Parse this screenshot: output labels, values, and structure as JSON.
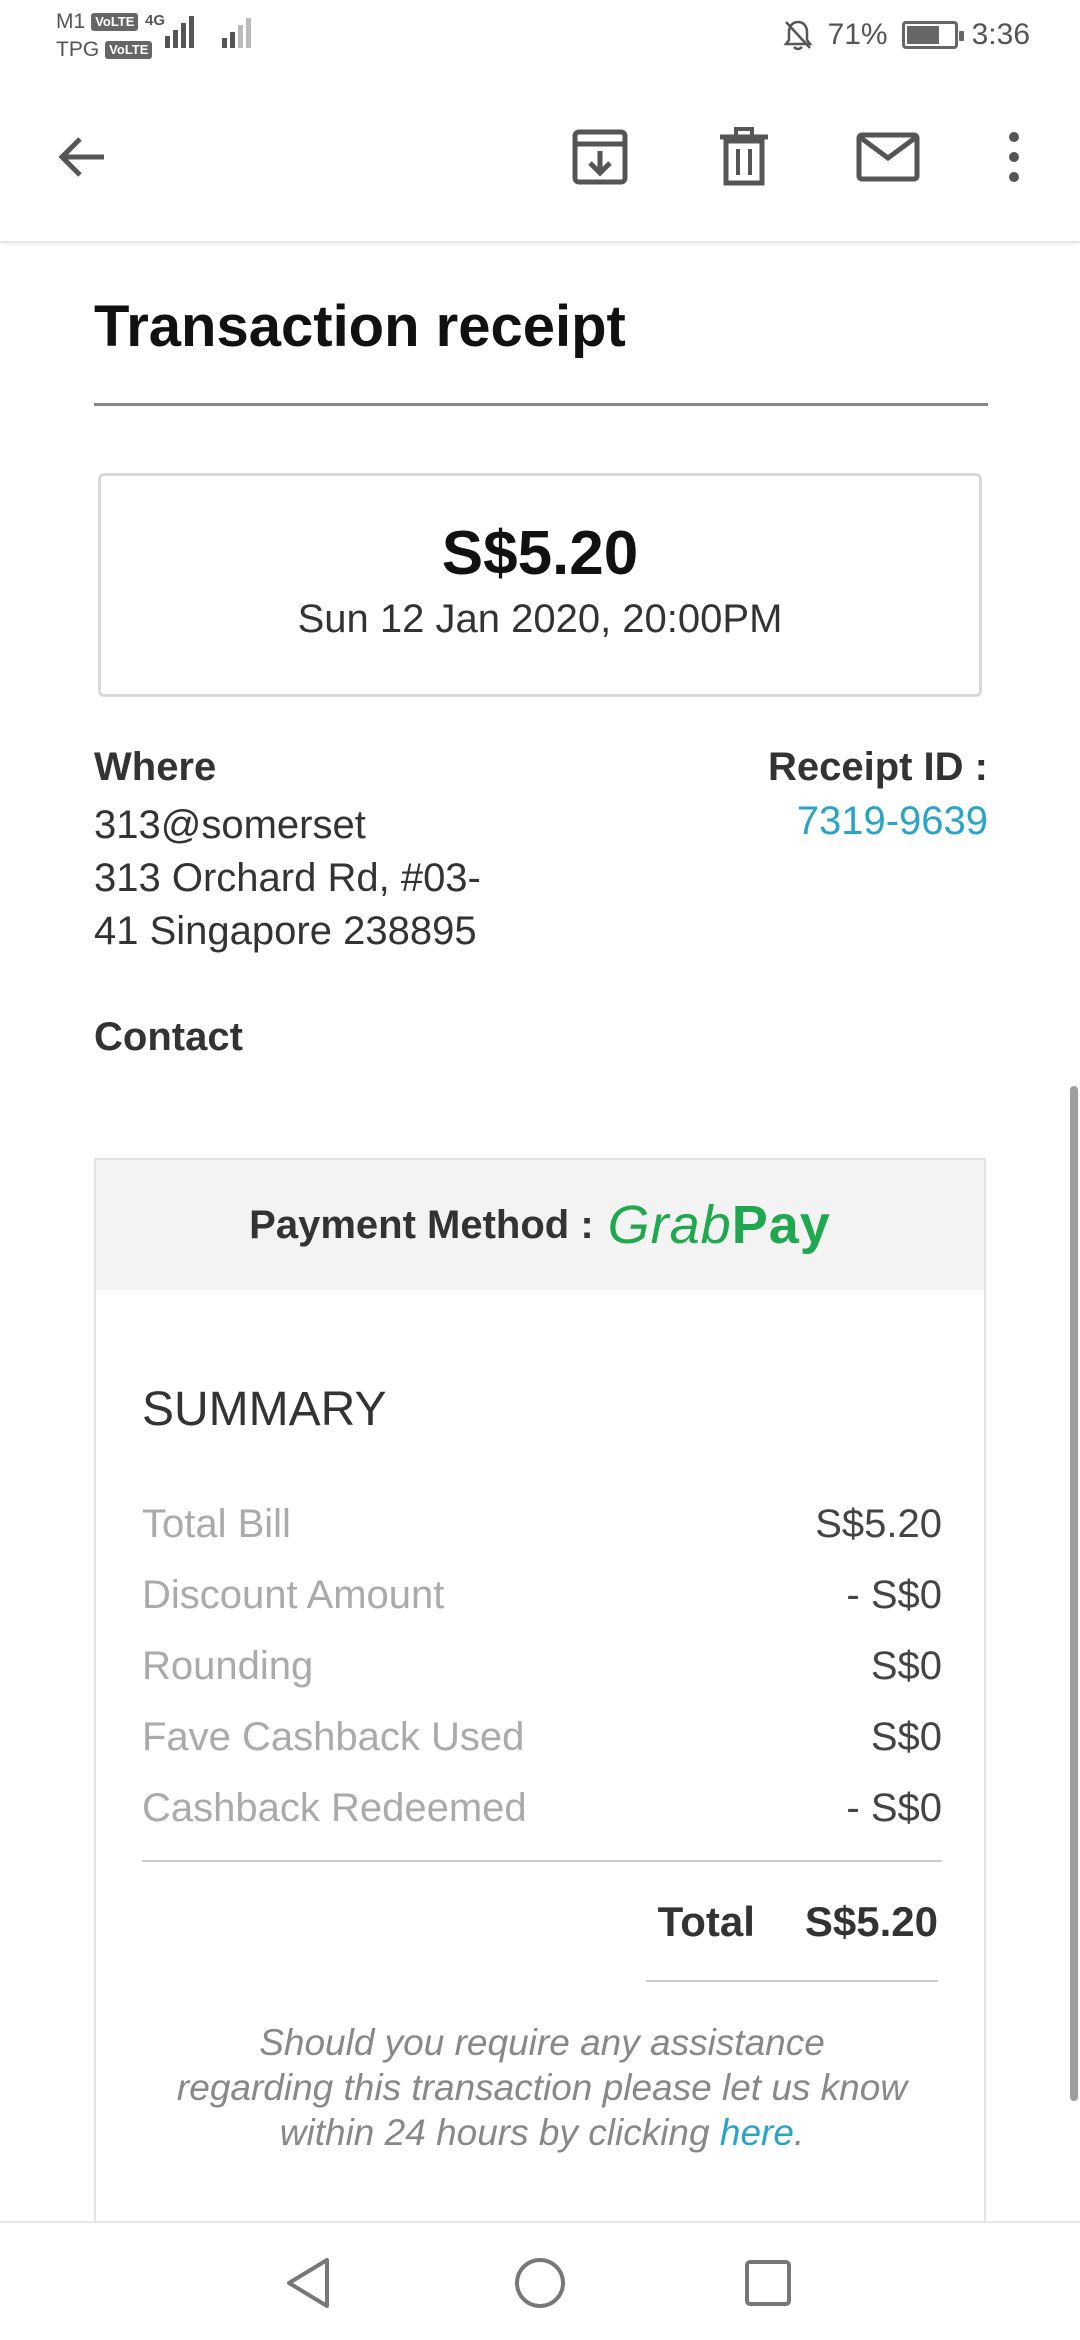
{
  "status_bar": {
    "carrier1": "M1",
    "carrier2": "TPG",
    "volte": "VoLTE",
    "network": "4G",
    "battery_percent": "71%",
    "battery_level": 0.71,
    "time": "3:36"
  },
  "toolbar": {
    "back_icon": "arrow-left-icon",
    "archive_icon": "archive-icon",
    "delete_icon": "trash-icon",
    "mail_icon": "mail-icon",
    "more_icon": "more-vertical-icon"
  },
  "receipt": {
    "title": "Transaction receipt",
    "amount": "S$5.20",
    "date": "Sun 12 Jan 2020, 20:00PM",
    "where_label": "Where",
    "where_name": "313@somerset",
    "where_addr1": "313 Orchard Rd, #03-",
    "where_addr2": "41 Singapore 238895",
    "receipt_id_label": "Receipt ID :",
    "receipt_id": "7319-9639",
    "contact_label": "Contact"
  },
  "payment": {
    "label": "Payment Method :",
    "brand_part1": "Grab",
    "brand_part2": "Pay",
    "brand_color": "#1fa84f"
  },
  "summary": {
    "title": "SUMMARY",
    "rows": [
      {
        "label": "Total Bill",
        "value": "S$5.20"
      },
      {
        "label": "Discount Amount",
        "value": "- S$0"
      },
      {
        "label": "Rounding",
        "value": "S$0"
      },
      {
        "label": "Fave Cashback Used",
        "value": "S$0"
      },
      {
        "label": "Cashback Redeemed",
        "value": "- S$0"
      }
    ],
    "total_label": "Total",
    "total_value": "S$5.20",
    "assist_text": "Should you require any assistance regarding this transaction please let us know within 24 hours by clicking",
    "assist_link": "here",
    "assist_end": "."
  },
  "nav": {
    "back": "nav-back-icon",
    "home": "nav-home-icon",
    "recents": "nav-recents-icon"
  },
  "colors": {
    "link": "#2aa3c8",
    "grabpay": "#1fa84f"
  }
}
